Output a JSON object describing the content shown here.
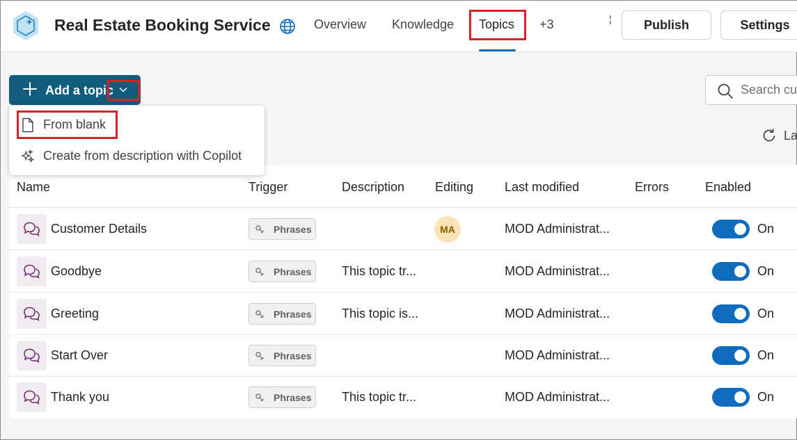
{
  "header": {
    "title": "Real Estate Booking Service",
    "tabs": [
      {
        "label": "Overview"
      },
      {
        "label": "Knowledge"
      },
      {
        "label": "Topics",
        "active": true
      },
      {
        "label": "+3"
      }
    ],
    "separator": "¦",
    "publish_label": "Publish",
    "settings_label": "Settings"
  },
  "toolbar": {
    "add_topic_label": "Add a topic",
    "search_placeholder": "Search cu",
    "refresh_label": "La"
  },
  "dropdown": {
    "items": [
      {
        "label": "From blank",
        "icon": "document-icon"
      },
      {
        "label": "Create from description with Copilot",
        "icon": "sparkle-icon"
      }
    ]
  },
  "table": {
    "columns": [
      "Name",
      "Trigger",
      "Description",
      "Editing",
      "Last modified",
      "Errors",
      "Enabled"
    ],
    "rows": [
      {
        "name": "Customer Details",
        "trigger": "Phrases",
        "description": "",
        "editing": "MA",
        "last_modified": "MOD Administrat...",
        "errors": "",
        "enabled": "On"
      },
      {
        "name": "Goodbye",
        "trigger": "Phrases",
        "description": "This topic tr...",
        "editing": "",
        "last_modified": "MOD Administrat...",
        "errors": "",
        "enabled": "On"
      },
      {
        "name": "Greeting",
        "trigger": "Phrases",
        "description": "This topic is...",
        "editing": "",
        "last_modified": "MOD Administrat...",
        "errors": "",
        "enabled": "On"
      },
      {
        "name": "Start Over",
        "trigger": "Phrases",
        "description": "",
        "editing": "",
        "last_modified": "MOD Administrat...",
        "errors": "",
        "enabled": "On"
      },
      {
        "name": "Thank you",
        "trigger": "Phrases",
        "description": "This topic tr...",
        "editing": "",
        "last_modified": "MOD Administrat...",
        "errors": "",
        "enabled": "On"
      }
    ]
  },
  "colors": {
    "primary": "#0f5c7c",
    "accent": "#0f6cbd",
    "highlight": "#d92027",
    "topic_icon_bg": "#f1ebf1",
    "avatar_bg": "#fbe3b6"
  }
}
